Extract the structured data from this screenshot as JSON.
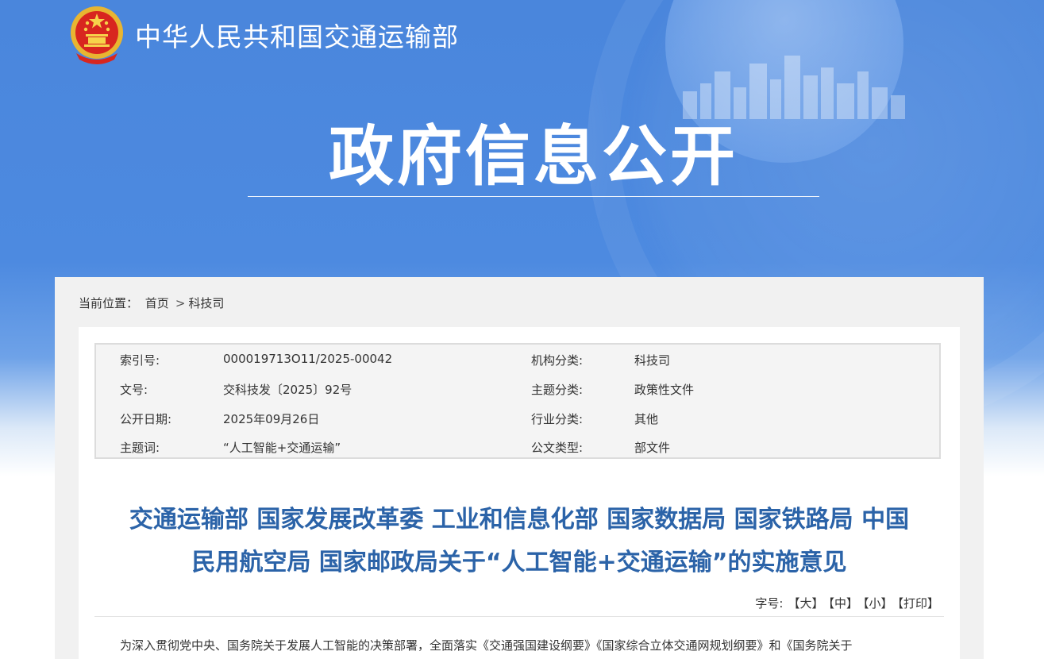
{
  "header": {
    "site_title": "中华人民共和国交通运输部",
    "section_title": "政府信息公开"
  },
  "breadcrumb": {
    "prefix": "当前位置：",
    "items": [
      "首页",
      "科技司"
    ],
    "separator": ">"
  },
  "meta": {
    "rows": [
      {
        "label1": "索引号:",
        "value1": "000019713O11/2025-00042",
        "label2": "机构分类:",
        "value2": "科技司"
      },
      {
        "label1": "文号:",
        "value1": "交科技发〔2025〕92号",
        "label2": "主题分类:",
        "value2": "政策性文件"
      },
      {
        "label1": "公开日期:",
        "value1": "2025年09月26日",
        "label2": "行业分类:",
        "value2": "其他"
      },
      {
        "label1": "主题词:",
        "value1": "“人工智能+交通运输”",
        "label2": "公文类型:",
        "value2": "部文件"
      }
    ]
  },
  "document": {
    "title_line1": "交通运输部 国家发展改革委 工业和信息化部 国家数据局 国家铁路局 中国",
    "title_line2": "民用航空局 国家邮政局关于“人工智能+交通运输”的实施意见",
    "body_first_line": "为深入贯彻党中央、国务院关于发展人工智能的决策部署，全面落实《交通强国建设纲要》《国家综合立体交通网规划纲要》和《国务院关于"
  },
  "font_size_controls": {
    "label": "字号:",
    "large": "【大】",
    "medium": "【中】",
    "small": "【小】",
    "print": "【打印】"
  },
  "colors": {
    "hero_blue": "#4a86dc",
    "title_blue": "#2b63a8",
    "panel_gray": "#f1f1f1"
  }
}
